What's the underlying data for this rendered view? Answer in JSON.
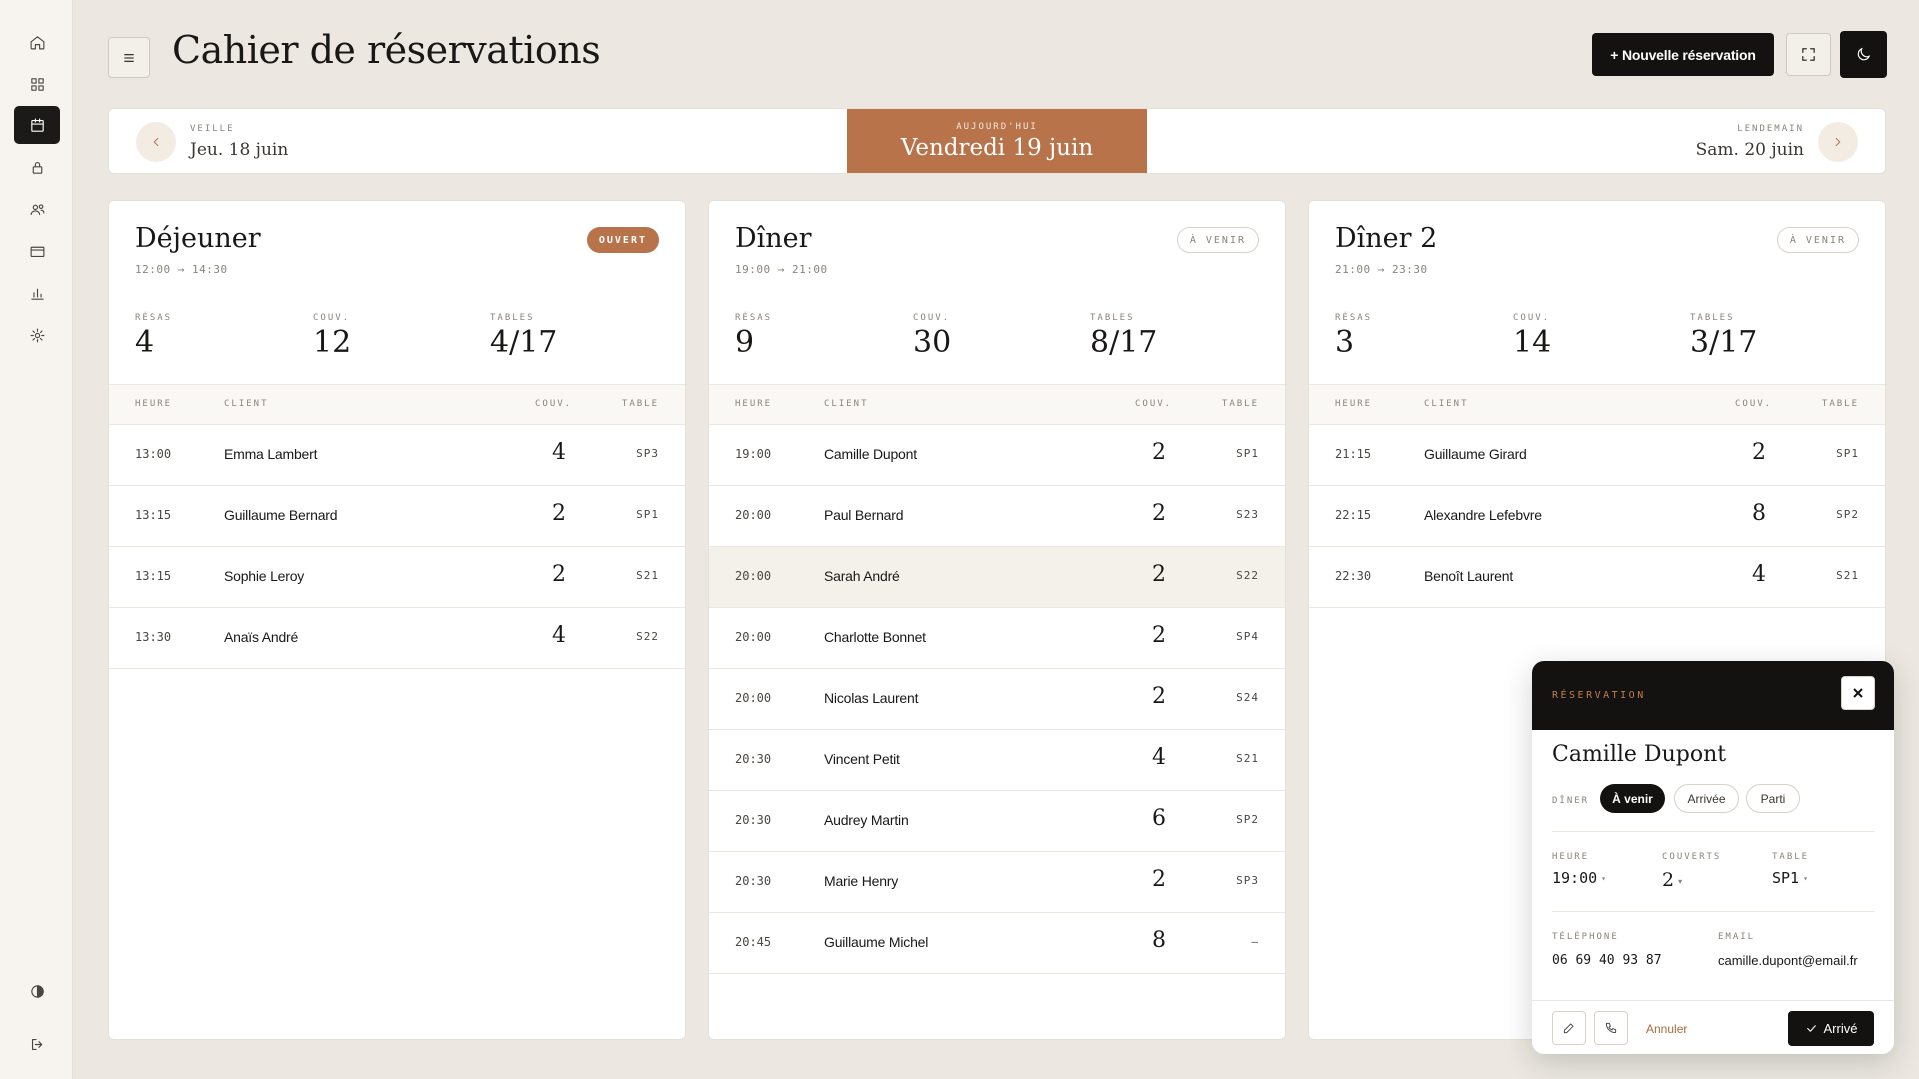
{
  "header": {
    "title": "Cahier de réservations",
    "new_button": "+ Nouvelle réservation"
  },
  "sidebar": {
    "items": [
      {
        "icon": "home-icon",
        "active": false
      },
      {
        "icon": "grid-icon",
        "active": false
      },
      {
        "icon": "calendar-icon",
        "active": true
      },
      {
        "icon": "lock-icon",
        "active": false
      },
      {
        "icon": "users-icon",
        "active": false
      },
      {
        "icon": "card-icon",
        "active": false
      },
      {
        "icon": "bar-chart-icon",
        "active": false
      },
      {
        "icon": "settings-icon",
        "active": false
      }
    ],
    "bottom": [
      {
        "icon": "contrast-icon"
      },
      {
        "icon": "logout-icon"
      }
    ]
  },
  "dates": {
    "prev_label": "VEILLE",
    "prev_value": "Jeu. 18 juin",
    "today_label": "AUJOURD'HUI",
    "today_value": "Vendredi 19 juin",
    "next_label": "LENDEMAIN",
    "next_value": "Sam. 20 juin"
  },
  "table_headers": {
    "heure": "HEURE",
    "client": "CLIENT",
    "couv": "COUV.",
    "table": "TABLE"
  },
  "stat_labels": {
    "resas": "RÉSAS",
    "couv": "COUV.",
    "tables": "TABLES"
  },
  "services": [
    {
      "name": "Déjeuner",
      "hours": "12:00 → 14:30",
      "status": "OUVERT",
      "resas": "4",
      "couv": "12",
      "tables": "4/17",
      "rows": [
        {
          "time": "13:00",
          "client": "Emma Lambert",
          "couv": "4",
          "table": "SP3"
        },
        {
          "time": "13:15",
          "client": "Guillaume Bernard",
          "couv": "2",
          "table": "SP1"
        },
        {
          "time": "13:15",
          "client": "Sophie Leroy",
          "couv": "2",
          "table": "S21"
        },
        {
          "time": "13:30",
          "client": "Anaïs André",
          "couv": "4",
          "table": "S22"
        }
      ]
    },
    {
      "name": "Dîner",
      "hours": "19:00 → 21:00",
      "status": "À VENIR",
      "resas": "9",
      "couv": "30",
      "tables": "8/17",
      "rows": [
        {
          "time": "19:00",
          "client": "Camille Dupont",
          "couv": "2",
          "table": "SP1"
        },
        {
          "time": "20:00",
          "client": "Paul Bernard",
          "couv": "2",
          "table": "S23"
        },
        {
          "time": "20:00",
          "client": "Sarah André",
          "couv": "2",
          "table": "S22"
        },
        {
          "time": "20:00",
          "client": "Charlotte Bonnet",
          "couv": "2",
          "table": "SP4"
        },
        {
          "time": "20:00",
          "client": "Nicolas Laurent",
          "couv": "2",
          "table": "S24"
        },
        {
          "time": "20:30",
          "client": "Vincent Petit",
          "couv": "4",
          "table": "S21"
        },
        {
          "time": "20:30",
          "client": "Audrey Martin",
          "couv": "6",
          "table": "SP2"
        },
        {
          "time": "20:30",
          "client": "Marie Henry",
          "couv": "2",
          "table": "SP3"
        },
        {
          "time": "20:45",
          "client": "Guillaume Michel",
          "couv": "8",
          "table": "—"
        }
      ]
    },
    {
      "name": "Dîner 2",
      "hours": "21:00 → 23:30",
      "status": "À VENIR",
      "resas": "3",
      "couv": "14",
      "tables": "3/17",
      "rows": [
        {
          "time": "21:15",
          "client": "Guillaume Girard",
          "couv": "2",
          "table": "SP1"
        },
        {
          "time": "22:15",
          "client": "Alexandre Lefebvre",
          "couv": "8",
          "table": "SP2"
        },
        {
          "time": "22:30",
          "client": "Benoît Laurent",
          "couv": "4",
          "table": "S21"
        }
      ]
    }
  ],
  "popup": {
    "title": "RÉSERVATION",
    "name": "Camille Dupont",
    "service": "DÎNER",
    "states": [
      "À venir",
      "Arrivée",
      "Parti"
    ],
    "active_state": "À venir",
    "heure_label": "HEURE",
    "heure": "19:00",
    "couverts_label": "COUVERTS",
    "couverts": "2",
    "table_label": "TABLE",
    "table": "SP1",
    "phone_label": "TÉLÉPHONE",
    "phone": "06 69 40 93 87",
    "email_label": "EMAIL",
    "email": "camille.dupont@email.fr",
    "cancel": "Annuler",
    "arrive": "Arrivé"
  },
  "colors": {
    "accent": "#b8734a",
    "dark": "#141210",
    "background": "#ece8e1"
  }
}
